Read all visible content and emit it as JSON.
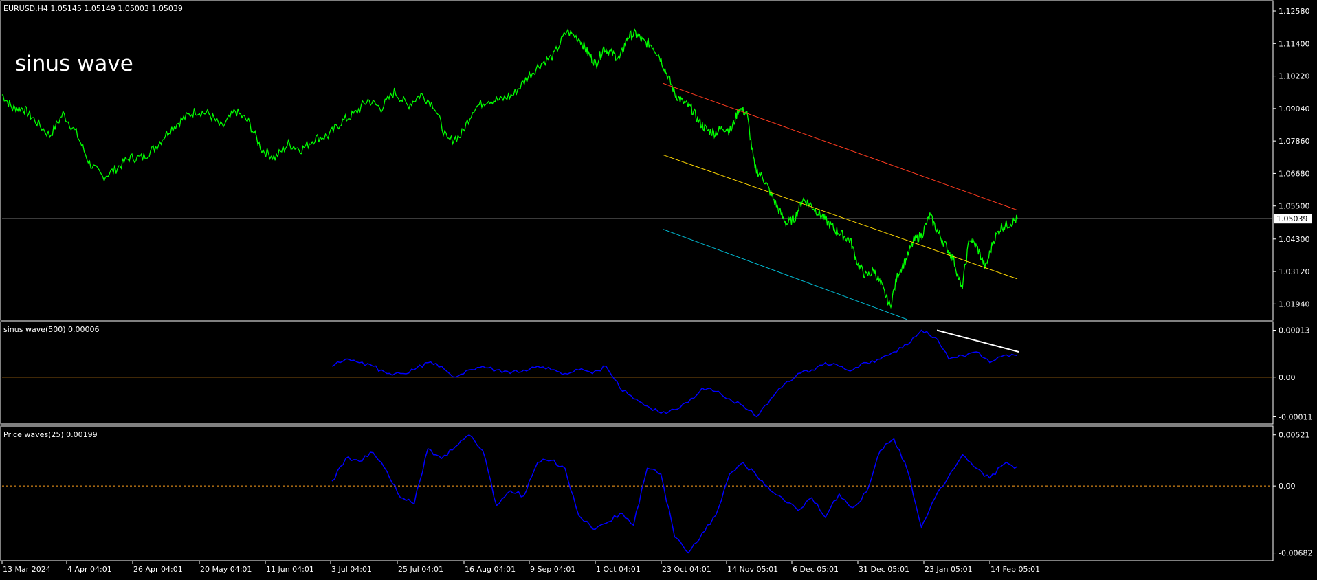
{
  "colors": {
    "background": "#000000",
    "frame": "#ffffff",
    "price": "#00ff00",
    "indicator": "#0000ff",
    "channel_upper": "#ff3b1f",
    "channel_middle": "#ffd700",
    "channel_lower": "#00bcd4",
    "trend_line": "#ffffff",
    "zero_line": "#ff9f1c",
    "text": "#ffffff",
    "price_line": "#9e9e9e"
  },
  "header": {
    "symbol_info": "EURUSD,H4  1.05145 1.05149 1.05003 1.05039"
  },
  "overlay_text": "sinus wave",
  "chart_data": [
    {
      "type": "line",
      "name": "main-price-chart",
      "ylim": [
        1.0135,
        1.1288
      ],
      "y_ticks": [
        "1.12580",
        "1.11400",
        "1.10220",
        "1.09040",
        "1.07860",
        "1.06680",
        "1.05500",
        "1.04300",
        "1.03120",
        "1.01940"
      ],
      "current_price": "1.05039",
      "series": [
        {
          "name": "",
          "x": [
            0,
            4,
            8,
            12,
            18,
            23,
            28,
            33,
            38,
            43,
            48,
            53,
            58,
            63,
            68,
            73,
            78,
            83,
            88,
            93,
            98,
            103,
            108,
            113,
            118,
            123,
            128,
            133,
            138,
            143,
            148,
            153,
            158,
            163,
            168,
            173,
            178,
            183,
            188,
            193,
            198,
            203,
            208,
            213,
            218,
            221,
            224,
            227,
            230,
            233,
            236,
            239,
            242,
            245,
            248,
            251,
            254,
            257,
            260,
            263,
            266,
            269,
            272,
            275,
            278,
            281,
            284,
            287,
            290,
            293,
            296,
            299,
            302,
            305,
            308,
            311,
            314,
            317,
            320,
            323,
            326,
            329,
            332,
            335,
            338,
            341,
            344,
            347,
            350,
            353,
            356,
            359,
            362,
            365,
            368,
            371,
            374,
            377,
            380,
            383
          ],
          "values": [
            1.0955,
            1.0905,
            1.0905,
            1.0865,
            1.0805,
            1.0885,
            1.0815,
            1.0705,
            1.0655,
            1.0685,
            1.0725,
            1.0725,
            1.0765,
            1.0825,
            1.0865,
            1.0895,
            1.0885,
            1.0835,
            1.0895,
            1.0855,
            1.0755,
            1.0725,
            1.0775,
            1.0755,
            1.0795,
            1.0805,
            1.0855,
            1.0885,
            1.0935,
            1.0905,
            1.0965,
            1.0915,
            1.0955,
            1.0915,
            1.0785,
            1.0805,
            1.0905,
            1.0935,
            1.0935,
            1.0955,
            1.1015,
            1.1065,
            1.1095,
            1.1185,
            1.1155,
            1.1105,
            1.1065,
            1.1125,
            1.1105,
            1.1085,
            1.1165,
            1.1175,
            1.1145,
            1.1135,
            1.1095,
            1.1025,
            1.0955,
            1.0925,
            1.0905,
            1.0855,
            1.0825,
            1.0815,
            1.0835,
            1.0825,
            1.0905,
            1.0885,
            1.0685,
            1.0655,
            1.0595,
            1.0535,
            1.0485,
            1.0505,
            1.0575,
            1.0555,
            1.0525,
            1.0495,
            1.0465,
            1.0445,
            1.0425,
            1.0335,
            1.0295,
            1.0315,
            1.0255,
            1.0185,
            1.0305,
            1.0355,
            1.0425,
            1.0445,
            1.0515,
            1.0455,
            1.0405,
            1.0355,
            1.0245,
            1.0435,
            1.0395,
            1.0325,
            1.0425,
            1.0475,
            1.0485,
            1.0504
          ]
        }
      ],
      "channel": {
        "x": [
          0,
          1
        ],
        "upper_at_x": [
          1.0995,
          1.0535
        ],
        "middle_at_x": [
          1.0735,
          1.0285
        ],
        "lower_at_x": [
          1.0465,
          1.019
        ]
      }
    },
    {
      "type": "line",
      "name": "sinus-wave-indicator",
      "label": "sinus wave(500) 0.00006",
      "ylim": [
        -0.00013,
        0.00015
      ],
      "y_ticks": [
        "0.00013",
        "0.00",
        "-0.00011"
      ],
      "series": [
        {
          "name": "",
          "x": [
            0,
            10,
            20,
            30,
            40,
            50,
            60,
            70,
            80,
            90,
            100,
            110,
            120,
            130,
            140,
            150,
            160,
            170,
            180,
            190,
            200,
            210,
            220,
            230,
            240,
            250,
            260,
            270,
            280,
            290,
            300,
            310,
            320,
            330,
            340,
            350,
            360,
            370,
            380,
            390,
            400,
            410,
            420,
            430,
            440,
            450,
            460,
            470,
            480,
            490,
            500
          ],
          "values": [
            3e-05,
            5e-05,
            4e-05,
            3e-05,
            1e-05,
            1e-05,
            2e-05,
            4e-05,
            3e-05,
            0.0,
            2e-05,
            3e-05,
            2e-05,
            1e-05,
            2e-05,
            3e-05,
            2e-05,
            1e-05,
            2e-05,
            1e-05,
            3e-05,
            -3e-05,
            -6e-05,
            -8e-05,
            -0.0001,
            -9e-05,
            -7e-05,
            -3e-05,
            -4e-05,
            -6e-05,
            -8e-05,
            -0.00011,
            -6e-05,
            -2e-05,
            1e-05,
            2e-05,
            4e-05,
            3e-05,
            2e-05,
            4e-05,
            5e-05,
            7e-05,
            9e-05,
            0.00013,
            0.00011,
            5e-05,
            6e-05,
            7e-05,
            4e-05,
            6e-05,
            6e-05
          ]
        }
      ],
      "trend_line": {
        "x": [
          0.82,
          1.0
        ],
        "values": [
          0.00013,
          7e-05
        ]
      }
    },
    {
      "type": "line",
      "name": "price-waves-indicator",
      "label": "Price waves(25) 0.00199",
      "ylim": [
        -0.0072,
        0.0054
      ],
      "y_ticks": [
        "0.00521",
        "0.00",
        "-0.00682"
      ],
      "series": [
        {
          "name": "",
          "x": [
            0,
            10,
            20,
            30,
            40,
            50,
            60,
            70,
            80,
            90,
            100,
            110,
            120,
            130,
            140,
            150,
            160,
            170,
            180,
            190,
            200,
            210,
            220,
            230,
            240,
            250,
            260,
            270,
            280,
            290,
            300,
            310,
            320,
            330,
            340,
            350,
            360,
            370,
            380,
            390,
            400,
            410,
            420,
            430,
            440,
            450,
            460,
            470,
            480,
            490,
            500
          ],
          "values": [
            0.0005,
            0.0028,
            0.0025,
            0.0034,
            0.0015,
            -0.0012,
            -0.0018,
            0.0038,
            0.0028,
            0.004,
            0.0052,
            0.0036,
            -0.002,
            -0.0005,
            -0.001,
            0.0024,
            0.0026,
            0.0018,
            -0.003,
            -0.0044,
            -0.0038,
            -0.0028,
            -0.004,
            0.0018,
            0.0012,
            -0.0052,
            -0.0068,
            -0.0048,
            -0.003,
            0.0012,
            0.0024,
            0.001,
            -0.0005,
            -0.0015,
            -0.0025,
            -0.0012,
            -0.0032,
            -0.0008,
            -0.0022,
            -0.0006,
            0.0036,
            0.0048,
            0.0015,
            -0.0042,
            -0.0012,
            0.001,
            0.0032,
            0.0018,
            0.0008,
            0.0022,
            0.002
          ]
        }
      ]
    }
  ],
  "time_axis": [
    "13 Mar 2024",
    "4 Apr 04:01",
    "26 Apr 04:01",
    "20 May 04:01",
    "11 Jun 04:01",
    "3 Jul 04:01",
    "25 Jul 04:01",
    "16 Aug 04:01",
    "9 Sep 04:01",
    "1 Oct 04:01",
    "23 Oct 04:01",
    "14 Nov 05:01",
    "6 Dec 05:01",
    "31 Dec 05:01",
    "23 Jan 05:01",
    "14 Feb 05:01"
  ]
}
